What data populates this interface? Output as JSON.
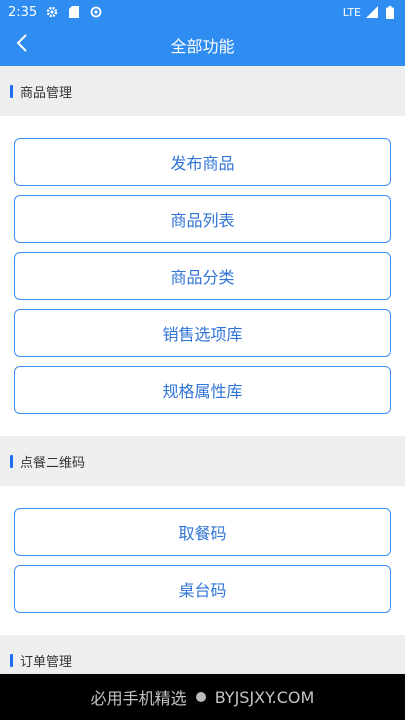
{
  "status_bar": {
    "time": "2:35",
    "network": "LTE"
  },
  "app_bar": {
    "title": "全部功能"
  },
  "sections": [
    {
      "title": "商品管理",
      "items": [
        "发布商品",
        "商品列表",
        "商品分类",
        "销售选项库",
        "规格属性库"
      ]
    },
    {
      "title": "点餐二维码",
      "items": [
        "取餐码",
        "桌台码"
      ]
    },
    {
      "title": "订单管理",
      "items": []
    }
  ],
  "watermark": {
    "left": "必用手机精选",
    "right": "BYJSJXY.COM"
  },
  "colors": {
    "primary": "#2f8cf0",
    "button_border": "#3d8ef4",
    "button_text": "#2f74d6",
    "section_bg": "#eeeeee",
    "accent_bar": "#1e6ff5"
  }
}
